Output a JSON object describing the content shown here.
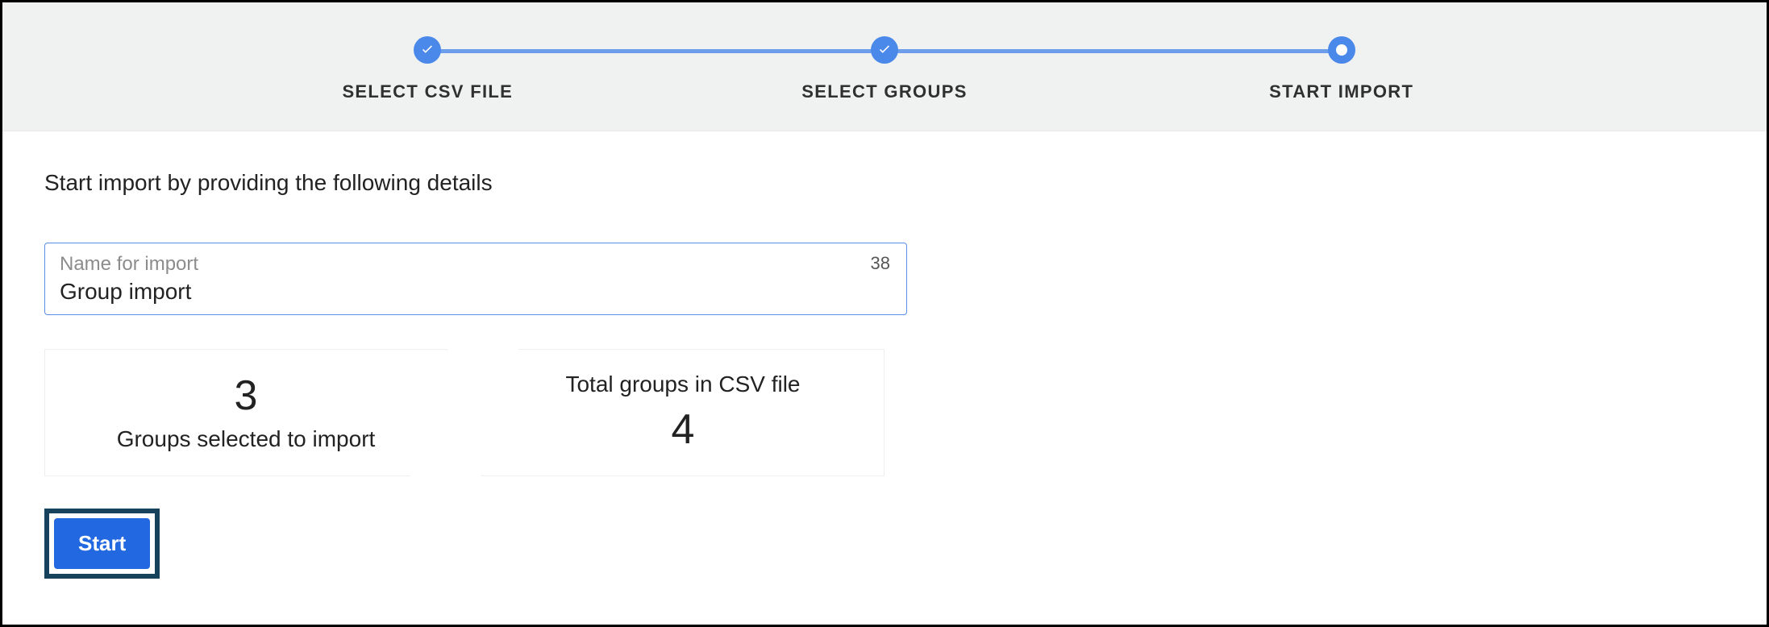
{
  "stepper": {
    "steps": [
      {
        "label": "SELECT CSV FILE",
        "state": "done"
      },
      {
        "label": "SELECT GROUPS",
        "state": "done"
      },
      {
        "label": "START IMPORT",
        "state": "current"
      }
    ]
  },
  "content": {
    "instructions": "Start import by providing the following details",
    "name_field": {
      "label": "Name for import",
      "value": "Group import",
      "remaining": "38"
    },
    "stats": {
      "selected_value": "3",
      "selected_label": "Groups selected to import",
      "total_label": "Total groups in CSV file",
      "total_value": "4"
    },
    "start_label": "Start"
  },
  "colors": {
    "accent": "#4a88e9",
    "button": "#2268e0",
    "outline": "#16425b"
  }
}
